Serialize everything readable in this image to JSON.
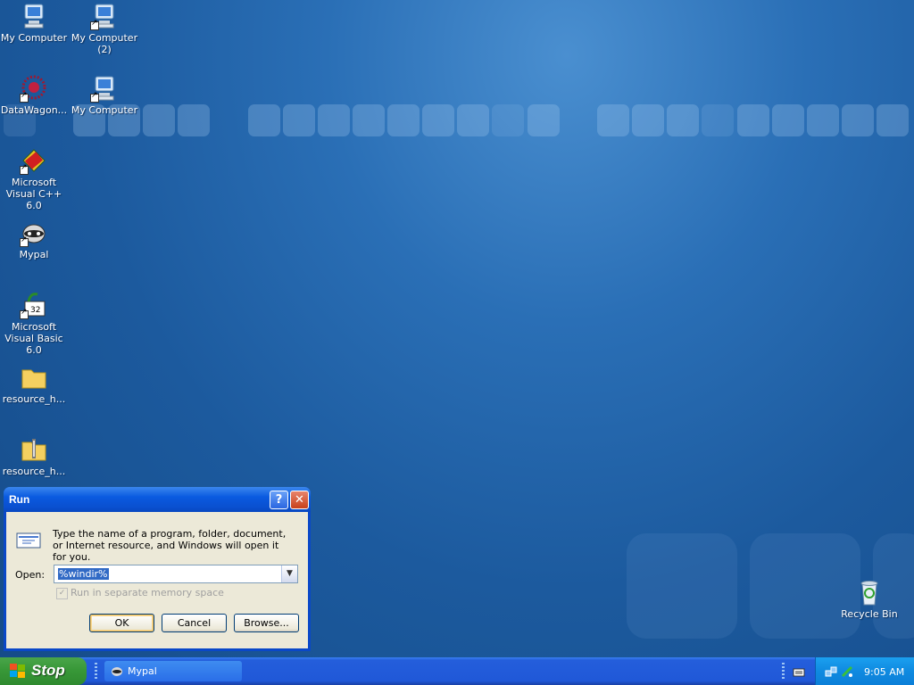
{
  "desktop": {
    "icons": [
      {
        "label": "My Computer"
      },
      {
        "label": "My Computer (2)"
      },
      {
        "label": "DataWagon..."
      },
      {
        "label": "My Computer"
      },
      {
        "label": "Microsoft Visual C++ 6.0"
      },
      {
        "label": "Mypal"
      },
      {
        "label": "Microsoft Visual Basic 6.0"
      },
      {
        "label": "resource_h..."
      },
      {
        "label": "resource_h..."
      },
      {
        "label": "Recycle Bin"
      }
    ]
  },
  "run_dialog": {
    "title": "Run",
    "description": "Type the name of a program, folder, document, or Internet resource, and Windows will open it for you.",
    "open_label": "Open:",
    "open_value": "%windir%",
    "checkbox_label": "Run in separate memory space",
    "ok_label": "OK",
    "cancel_label": "Cancel",
    "browse_label": "Browse..."
  },
  "taskbar": {
    "start_label": "Stop",
    "task_label": "Mypal",
    "clock": "9:05 AM"
  }
}
